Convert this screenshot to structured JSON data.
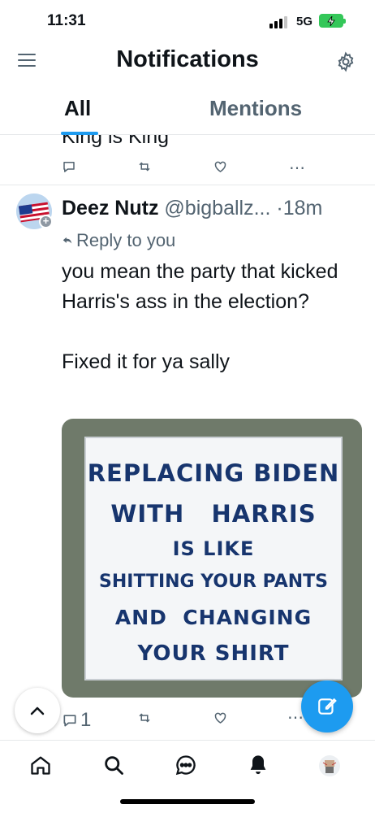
{
  "status_bar": {
    "time": "11:31",
    "network": "5G"
  },
  "header": {
    "title": "Notifications"
  },
  "tabs": [
    {
      "label": "All",
      "active": true
    },
    {
      "label": "Mentions",
      "active": false
    }
  ],
  "previous_tweet": {
    "text_fragment": "King is King"
  },
  "tweet": {
    "display_name": "Deez Nutz",
    "handle": "@bigballz...",
    "separator": " ·",
    "time": "18m",
    "reply_label": "Reply to you",
    "body": "you mean the party that kicked Harris's ass in the election?\n\nFixed it for ya sally",
    "image_sign_lines": [
      "REPLACING BIDEN",
      "WITH   HARRIS",
      "IS LIKE",
      "SHITTING YOUR PANTS",
      "AND  CHANGING",
      "YOUR SHIRT"
    ],
    "reply_count": "1"
  },
  "bottom_nav": {
    "items": [
      "home-icon",
      "search-icon",
      "messages-icon",
      "notifications-icon",
      "profile-avatar"
    ]
  },
  "colors": {
    "accent": "#1d9bf0",
    "muted_text": "#536471",
    "battery": "#34c759"
  }
}
